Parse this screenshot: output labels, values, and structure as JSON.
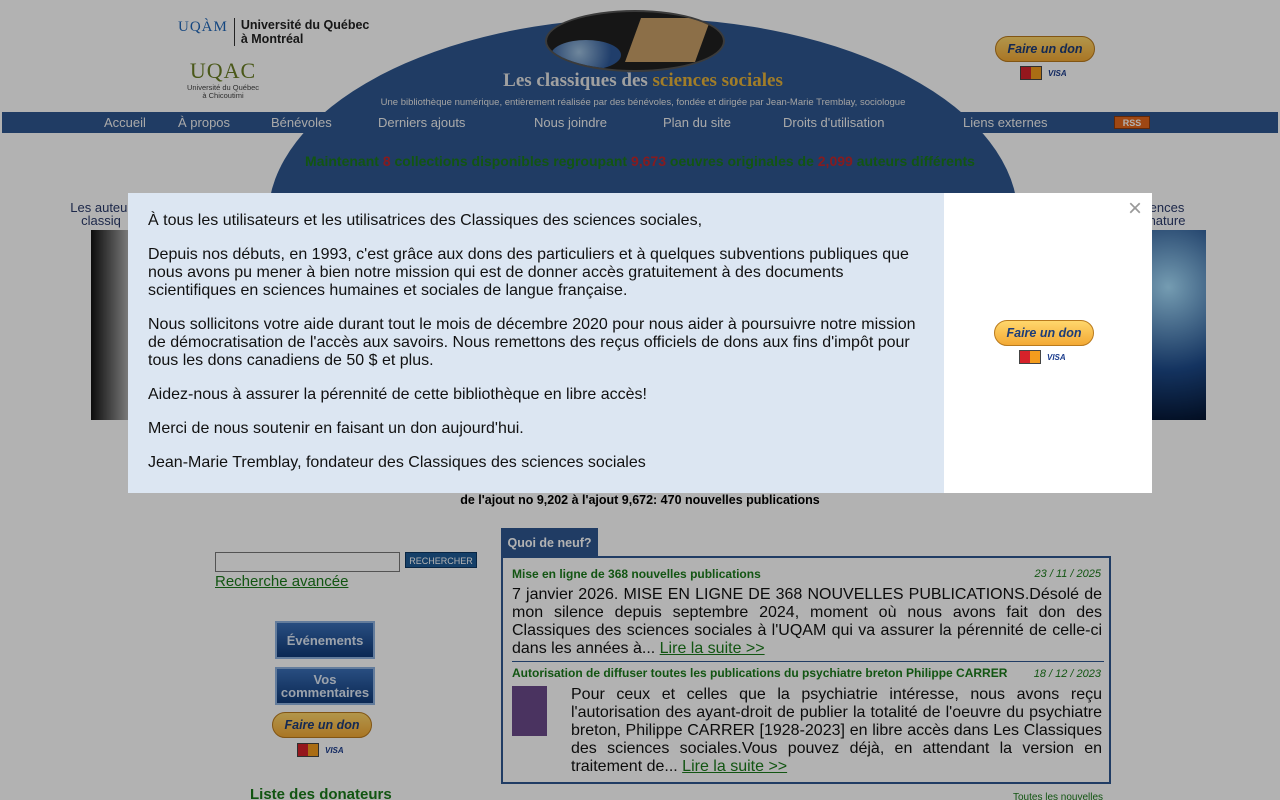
{
  "header": {
    "uqam_mark": "UQÀM",
    "uqam_name_line1": "Université du Québec",
    "uqam_name_line2": "à Montréal",
    "uqac_mark": "UQAC",
    "uqac_sub_line1": "Université du Québec",
    "uqac_sub_line2": "à Chicoutimi",
    "site_title_part1": "Les classiques des ",
    "site_title_part2": "sciences sociales",
    "site_subtitle": "Une bibliothèque numérique, entièrement réalisée par des bénévoles, fondée et dirigée par Jean-Marie Tremblay, sociologue",
    "donate_label": "Faire un don",
    "mc_label": "",
    "visa_label": "VISA"
  },
  "nav": {
    "items": [
      "Accueil",
      "À propos",
      "Bénévoles",
      "Derniers ajouts",
      "Nous joindre",
      "Plan du site",
      "Droits d'utilisation",
      "Liens externes"
    ],
    "rss": "RSS"
  },
  "counts": {
    "prefix": "Maintenant ",
    "collections": "8",
    "mid1": " collections disponibles regroupant ",
    "works": "9,673",
    "mid2": " oeuvres originales de ",
    "authors": "2,099",
    "suffix": " auteurs différents"
  },
  "collections": {
    "left_label_line1": "Les auteur",
    "left_label_line2": "classiq",
    "right_label_line1": "ences",
    "right_label_line2": "nature"
  },
  "added_text": "de l'ajout no 9,202 à l'ajout 9,672: 470 nouvelles publications",
  "search": {
    "value": "",
    "button": "RECHERCHER",
    "advanced": "Recherche avancée"
  },
  "sidebar": {
    "events": "Événements",
    "comments_line1": "Vos",
    "comments_line2": "commentaires",
    "donate": "Faire un don",
    "donors": "Liste des donateurs"
  },
  "news": {
    "tab": "Quoi de neuf?",
    "item1": {
      "title": "Mise en ligne de 368 nouvelles publications",
      "date": "23 / 11 / 2025",
      "text": "7 janvier 2026. MISE EN LIGNE DE 368 NOUVELLES PUBLICATIONS.Désolé de mon silence depuis septembre 2024, moment où nous avons fait don des Classiques des sciences sociales à l'UQAM qui va assurer la pérennité de celle-ci dans les années à... ",
      "more": "Lire la suite >>"
    },
    "item2": {
      "title": "Autorisation de diffuser toutes les publications du psychiatre breton Philippe CARRER",
      "date": "18 / 12 / 2023",
      "text": "Pour ceux et celles que la psychiatrie intéresse, nous avons reçu l'autorisation des ayant-droit de publier la totalité de l'oeuvre du psychiatre breton, Philippe CARRER [1928-2023] en libre accès dans Les Classiques des sciences sociales.Vous pouvez déjà, en attendant la version en traitement de... ",
      "more": "Lire la suite >>"
    },
    "all": "Toutes les nouvelles"
  },
  "modal": {
    "p1": "À tous les utilisateurs et les utilisatrices des Classiques des sciences sociales,",
    "p2": "Depuis nos débuts, en 1993, c'est grâce aux dons des particuliers et à quelques subventions publiques que nous avons pu mener à bien notre mission qui est de donner accès gratuitement à des documents scientifiques en sciences humaines et sociales de langue française.",
    "p3": "Nous sollicitons votre aide durant tout le mois de décembre 2020 pour nous aider à poursuivre notre mission de démocratisation de l'accès aux savoirs. Nous remettons des reçus officiels de dons aux fins d'impôt pour tous les dons canadiens de 50 $ et plus.",
    "p4": "Aidez-nous à assurer la pérennité de cette bibliothèque en libre accès!",
    "p5": "Merci de nous soutenir en faisant un don aujourd'hui.",
    "p6": "Jean-Marie Tremblay, fondateur des Classiques des sciences sociales",
    "close": "×",
    "donate": "Faire un don"
  },
  "colors": {
    "brand_blue": "#2e5790",
    "green_text": "#1a7a1a",
    "red_numbers": "#c0282d",
    "modal_bg": "#dce6f2"
  },
  "icons": [
    "paypal-donate-icon",
    "mastercard-icon",
    "visa-icon",
    "rss-icon",
    "close-icon",
    "globe-logo-icon"
  ]
}
